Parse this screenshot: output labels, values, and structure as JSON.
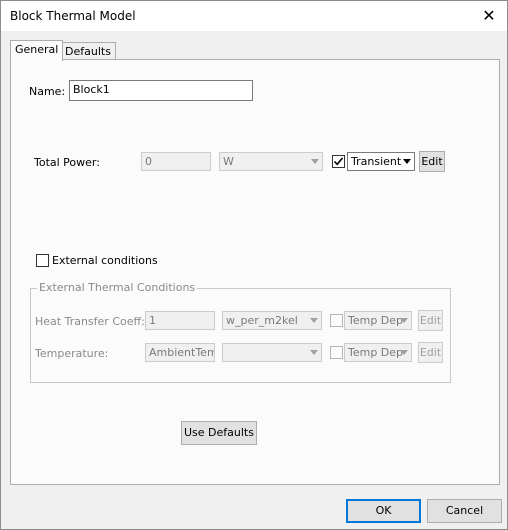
{
  "window": {
    "title": "Block Thermal Model",
    "close_symbol": "✕"
  },
  "tabs": [
    {
      "label": "General",
      "active": true
    },
    {
      "label": "Defaults",
      "active": false
    }
  ],
  "name": {
    "label": "Name:",
    "value": "Block1"
  },
  "total_power": {
    "label": "Total Power:",
    "value": "0",
    "unit": "W",
    "checked": true,
    "mode": "Transient",
    "edit_label": "Edit"
  },
  "external_conditions": {
    "label": "External conditions",
    "checked": false
  },
  "external_group": {
    "title": "External Thermal Conditions",
    "htc": {
      "label": "Heat Transfer Coeff:",
      "value": "1",
      "unit": "w_per_m2kel",
      "mode": "Temp Dep",
      "edit_label": "Edit"
    },
    "temperature": {
      "label": "Temperature:",
      "value": "AmbientTemp",
      "unit": "",
      "mode": "Temp Dep",
      "edit_label": "Edit"
    }
  },
  "use_defaults_label": "Use Defaults",
  "footer": {
    "ok_label": "OK",
    "cancel_label": "Cancel"
  }
}
